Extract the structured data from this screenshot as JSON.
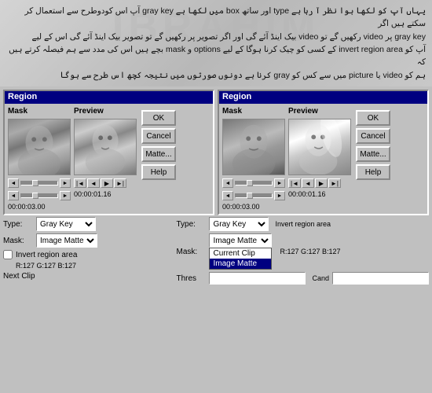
{
  "header": {
    "watermark": "IBRAHIM",
    "text_line1": "یہاں آپ کو لکھا ہوا نظر آ رہا ہے type اور ساتھ box میں لکھا ہے gray key آپ اس کودوطرح سے استعمال کر سکتے ہیں اگر",
    "text_line2": "gray key پر video رکھیں گے تو video بیک اینڈ آئے گی اور اگر تصویر پر رکھیں گے تو تصویر بیک اینڈ آئے گی اس کے لیے",
    "text_line3": "آپ کو invert region area کے کسی کو چیک کرنا ہوگا کے لیے options و mask بچے ہیں اس کی مدد سے ہم فیصلہ کرتے ہیں کہ",
    "text_line4": "ہم کو video یا picture میں سے کس کو gray کرنا ہے دونوں صورتوں میں نتیجہ کچھ اس طرح سے ہوگا"
  },
  "left_region": {
    "title": "Region",
    "mask_label": "Mask",
    "preview_label": "Preview",
    "timecode_mask": "00:00:03.00",
    "timecode_preview": "00:00:01.16",
    "type_label": "Type:",
    "type_value": "Gray Key",
    "mask_field_label": "Mask:",
    "mask_value": "Image Matte",
    "invert_label": "Invert region area",
    "coords": "R:127 G:127 B:127"
  },
  "right_region": {
    "title": "Region",
    "mask_label": "Mask",
    "preview_label": "Preview",
    "timecode_mask": "00:00:03.00",
    "timecode_preview": "00:00:01.16",
    "type_label": "Type:",
    "type_value": "Gray Key",
    "mask_field_label": "Mask:",
    "mask_value": "Image Matte",
    "invert_label": "Invert region area",
    "coords": "R:127 G:127 B:127",
    "thresh_label": "Thres",
    "cand_label": "Cand"
  },
  "buttons": {
    "ok": "OK",
    "cancel": "Cancel",
    "matte": "Matte...",
    "help": "Help"
  },
  "mask_dropdown_items": [
    "Current Clip",
    "Image Matte"
  ],
  "mask_dropdown_selected": "Image Matte"
}
